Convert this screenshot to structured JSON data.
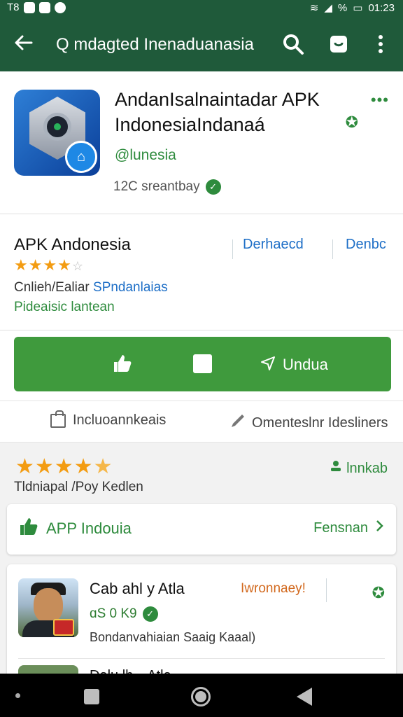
{
  "status_bar": {
    "time": "01:23",
    "left_text": "T8",
    "battery_text": "%"
  },
  "toolbar": {
    "title": "Q mdagted Inenaduanasia"
  },
  "app": {
    "title": "AndanIsalnaintadar APK IndonesiaIndanaá",
    "developer": "@lunesia",
    "size": "12C sreantbay"
  },
  "info": {
    "title": "APK Andonesia",
    "link1": "Derhaecd",
    "link2": "Denbc",
    "meta_prefix": "Cnlieh/Ealiar",
    "meta_blue": "SPndanlaias",
    "category": "Pideaisic lantean",
    "stars": "★★★★",
    "stars_empty": "☆"
  },
  "install": {
    "label": "Undua"
  },
  "links": {
    "left": "Incluoannkeais",
    "right": "Omenteslnr Idesliners"
  },
  "rating": {
    "stars": "★★★★",
    "half": "★",
    "subtitle": "Tldniapal /Poy Kedlen",
    "link": "lnnkab"
  },
  "app_row": {
    "left": "APP Indouia",
    "right": "Fensnan"
  },
  "review": {
    "name": "Cab ahl y Atla",
    "badge": "Iwronnaey!",
    "size": "ɑS 0 K9",
    "desc": "Bondanvahiaian Saaig Kaaal)",
    "peek_text": "Dalu   lh…Atla",
    "peek_badge": "—"
  }
}
